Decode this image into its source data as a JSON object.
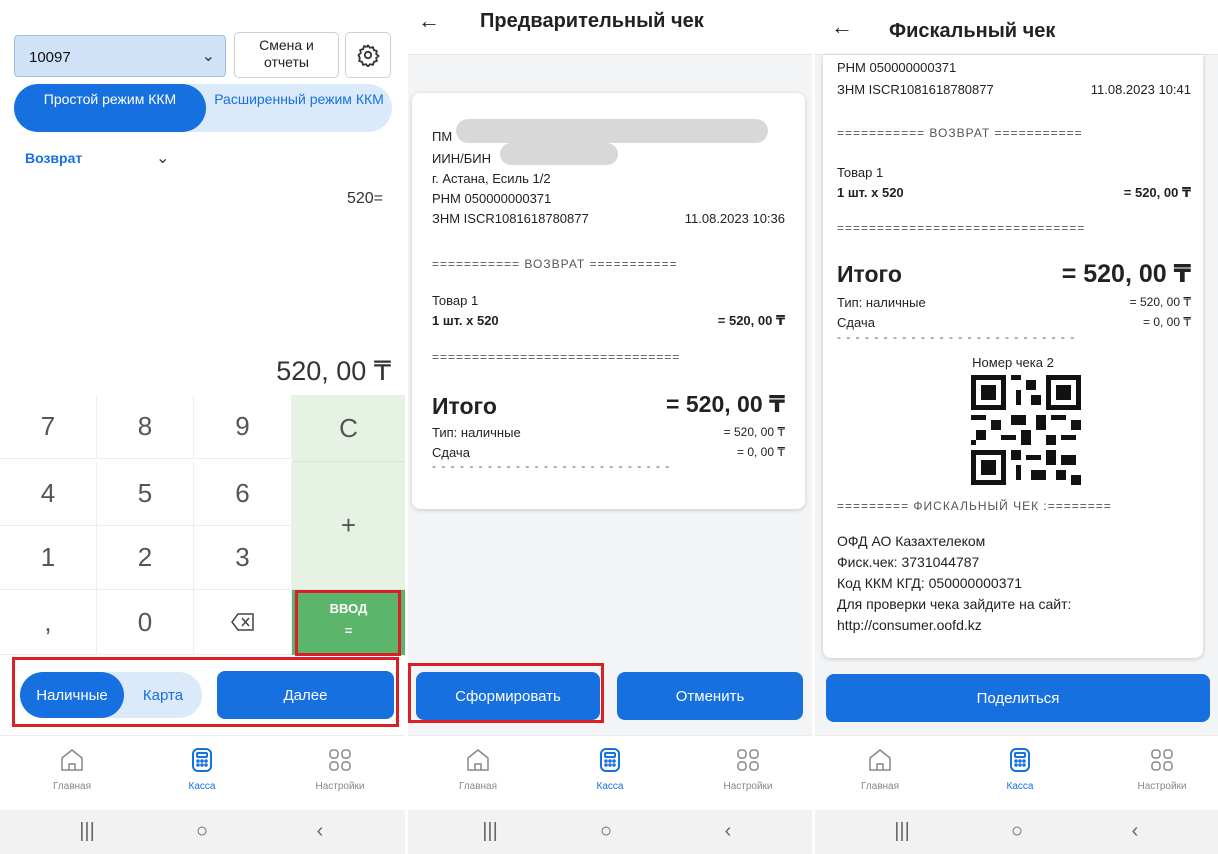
{
  "panel1": {
    "kkm_select_value": "10097",
    "shift_button_label": "Смена и отчеты",
    "mode_simple": "Простой режим ККМ",
    "mode_extended": "Расширенный режим ККМ",
    "operation_value": "Возврат",
    "expression": "520=",
    "total_display": "520, 00 ₸",
    "keys": {
      "k7": "7",
      "k8": "8",
      "k9": "9",
      "clear": "C",
      "k4": "4",
      "k5": "5",
      "k6": "6",
      "plus": "+",
      "k1": "1",
      "k2": "2",
      "k3": "3",
      "comma": ",",
      "k0": "0",
      "enter_line1": "ВВОД",
      "enter_line2": "="
    },
    "pay_cash": "Наличные",
    "pay_card": "Карта",
    "next_button": "Далее"
  },
  "nav": {
    "home": "Главная",
    "kassa": "Касса",
    "settings": "Настройки"
  },
  "panel2": {
    "title": "Предварительный чек",
    "receipt": {
      "pm_prefix": "ПМ",
      "iin_prefix": "ИИН/БИН",
      "address": "г. Астана, Есиль 1/2",
      "rnm": "РНМ 050000000371",
      "znm": "ЗНМ ISCR1081618780877",
      "datetime": "11.08.2023 10:36",
      "dash_return": "=========== ВОЗВРАТ ===========",
      "item_name": "Товар 1",
      "item_qty": "1 шт. х 520",
      "item_sum": "= 520, 00 ₸",
      "dash_full": "===============================",
      "total_label": "Итого",
      "total_value": "= 520, 00 ₸",
      "pay_type": "Тип: наличные",
      "pay_value": "= 520, 00 ₸",
      "change_label": "Сдача",
      "change_value": "= 0, 00 ₸",
      "dash_line": "- - - - - - - - - - - - - - - - - - - - - - - - - -"
    },
    "form_button": "Сформировать",
    "cancel_button": "Отменить"
  },
  "panel3": {
    "title": "Фискальный чек",
    "receipt": {
      "rnm": "РНМ 050000000371",
      "znm": "ЗНМ ISCR1081618780877",
      "datetime": "11.08.2023 10:41",
      "dash_return": "=========== ВОЗВРАТ ===========",
      "item_name": "Товар 1",
      "item_qty": "1 шт. х 520",
      "item_sum": "= 520, 00 ₸",
      "dash_full": "===============================",
      "total_label": "Итого",
      "total_value": "= 520, 00 ₸",
      "pay_type": "Тип: наличные",
      "pay_value": "= 520, 00 ₸",
      "change_label": "Сдача",
      "change_value": "= 0, 00 ₸",
      "dash_line": "- - - - - - - - - - - - - - - - - - - - - - - - - -",
      "check_number": "Номер чека 2",
      "dash_fiscal": "========= ФИСКАЛЬНЫЙ ЧЕК :========",
      "ofd": "ОФД АО Казахтелеком",
      "fisc": "Фиск.чек: 3731044787",
      "kkm_code": "Код ККМ КГД: 050000000371",
      "check_hint": "Для проверки чека зайдите на сайт:",
      "site": "http://consumer.oofd.kz"
    },
    "share_button": "Поделиться"
  },
  "colors": {
    "primary": "#1670e0",
    "primary_light": "#dbeafb",
    "enter_green": "#5bb56a",
    "key_green": "#e6f3e4",
    "highlight_red": "#dc1f26"
  }
}
